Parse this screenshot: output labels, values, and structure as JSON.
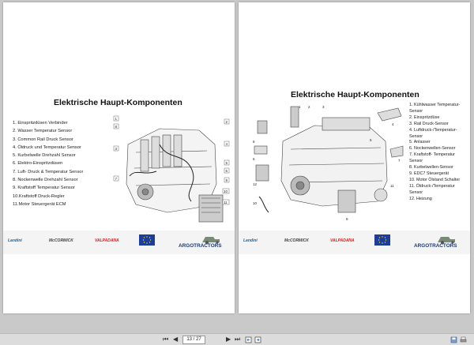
{
  "left_page": {
    "title": "Elektrische Haupt-Komponenten",
    "items": [
      "1.  Einspritzdüsen Verbinder",
      "2.  Wasser Temperatur Sensor",
      "3.  Common Rail Druck Sensor",
      "4.  Öldruck und Temperatur Sensor",
      "5.  Kurbelwelle Drehzahl Sensor",
      "6.  Elektro-Einspritzdüsen",
      "7.  Luft- Druck & Temperatur Sensor",
      "8.  Nockenwelle Drehzahl Sensor",
      "9.  Kraftstoff Temperatur Sensor",
      "10.Kraftstoff Druck-Regler",
      "11.Motor Steuergerät ECM"
    ],
    "diagram_callouts": [
      "1",
      "8",
      "2",
      "4",
      "3",
      "5",
      "6",
      "7",
      "9",
      "10",
      "11"
    ]
  },
  "right_page": {
    "title": "Elektrische Haupt-Komponenten",
    "items": [
      "1.  Kühlwasser Temperatur-Sensor",
      "2.  Einspritzdüse",
      "3.  Rail Druck-Sensor",
      "4.  Luftdruck-/Temperatur-Sensor",
      "5.  Anlasser",
      "6.  Nockenwellen-Sensor",
      "7.  Kraftstoff- Temperatur Sensor",
      "8.  Kurbelwellen-Sensor",
      "9.  EDC7 Steuergerät",
      "10. Motor Ölstand Schalter",
      "11. Öldruck-/Temperatur Sensor",
      "12. Heizung"
    ],
    "diagram_callouts": [
      "1",
      "2",
      "3",
      "4",
      "5",
      "6",
      "7",
      "8",
      "9",
      "10",
      "11",
      "12"
    ]
  },
  "footer_logos": {
    "landini": "Landini",
    "mccormick": "McCORMICK",
    "valpadana": "VALPADANA",
    "argo": "ARGOTRACTORS"
  },
  "toolbar": {
    "first": "⏮",
    "prev": "◀",
    "page_value": "13 / 27",
    "next": "▶",
    "last": "⏭",
    "page_count": ""
  },
  "colors": {
    "viewer_background": "#c9c9c9",
    "landini_blue": "#1466a8",
    "valpadana_red": "#dd2222",
    "argo_blue": "#1b3a78",
    "eu_blue": "#1c3d9c",
    "eu_yellow": "#ffd700"
  }
}
